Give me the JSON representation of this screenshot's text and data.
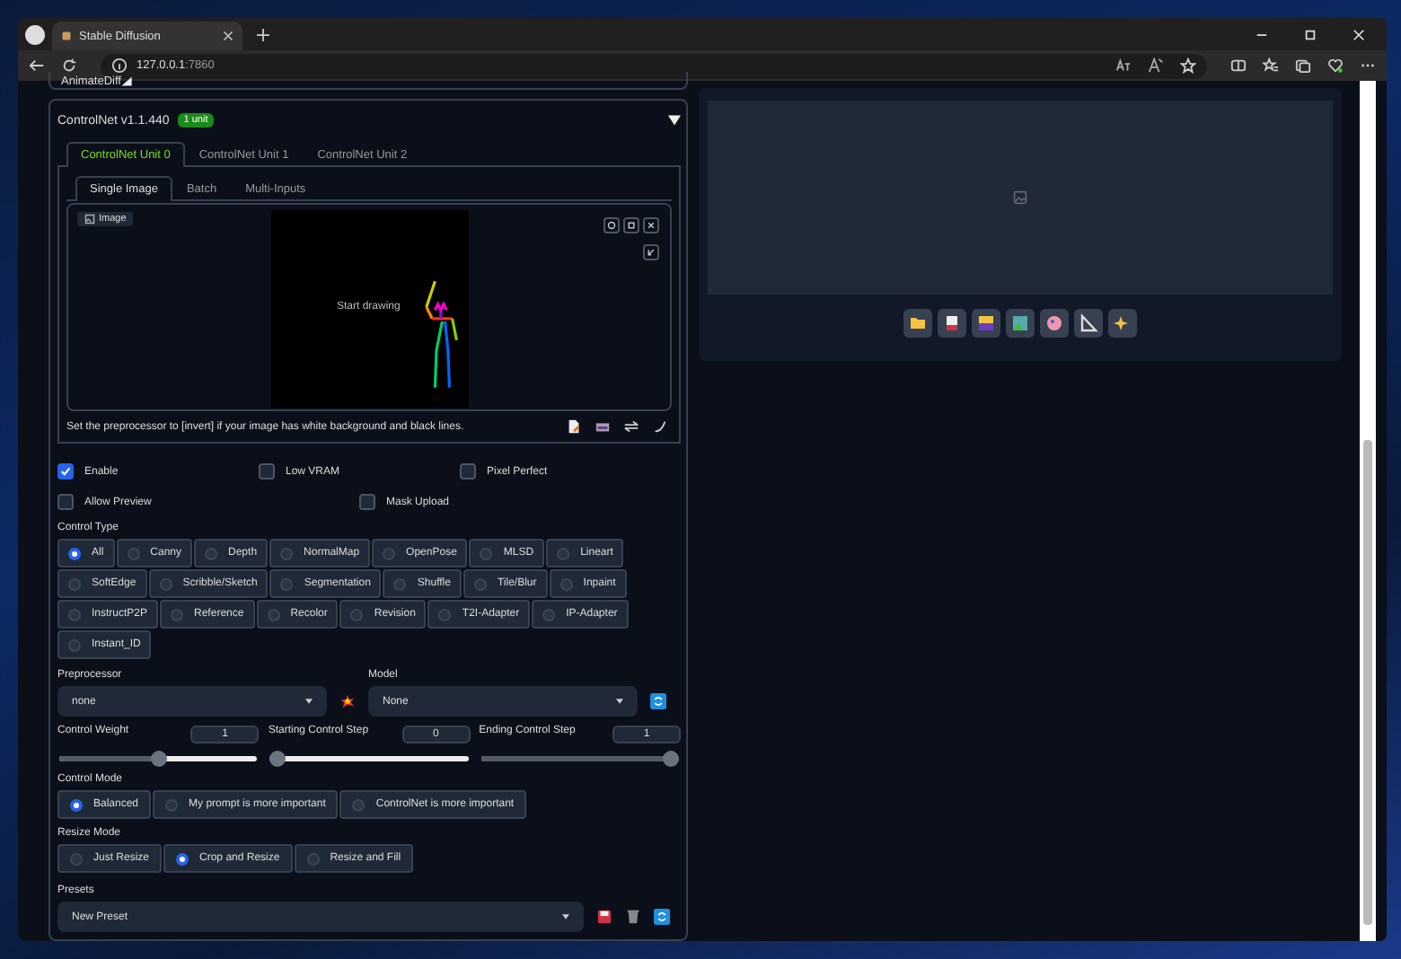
{
  "browser": {
    "tab_title": "Stable Diffusion",
    "address_host": "127.0.0.1",
    "address_port": ":7860"
  },
  "animatediff": {
    "title": "AnimateDiff"
  },
  "controlnet": {
    "title": "ControlNet v1.1.440",
    "badge": "1 unit",
    "expanded": true,
    "unit_tabs": [
      {
        "label": "ControlNet Unit 0",
        "selected": true
      },
      {
        "label": "ControlNet Unit 1",
        "selected": false
      },
      {
        "label": "ControlNet Unit 2",
        "selected": false
      }
    ],
    "input_tabs": [
      {
        "label": "Single Image",
        "selected": true
      },
      {
        "label": "Batch",
        "selected": false
      },
      {
        "label": "Multi-Inputs",
        "selected": false
      }
    ],
    "canvas": {
      "label": "Image",
      "hint": "Start drawing"
    },
    "note": "Set the preprocessor to [invert] if your image has white background and black lines.",
    "checkbox_rows": [
      [
        {
          "label": "Enable",
          "checked": true
        },
        {
          "label": "Low VRAM",
          "checked": false
        },
        {
          "label": "Pixel Perfect",
          "checked": false
        }
      ],
      [
        {
          "label": "Allow Preview",
          "checked": false
        },
        {
          "label": "Mask Upload",
          "checked": false
        }
      ]
    ],
    "control_type": {
      "label": "Control Type",
      "options": [
        {
          "label": "All",
          "selected": true
        },
        {
          "label": "Canny",
          "selected": false
        },
        {
          "label": "Depth",
          "selected": false
        },
        {
          "label": "NormalMap",
          "selected": false
        },
        {
          "label": "OpenPose",
          "selected": false
        },
        {
          "label": "MLSD",
          "selected": false
        },
        {
          "label": "Lineart",
          "selected": false
        },
        {
          "label": "SoftEdge",
          "selected": false
        },
        {
          "label": "Scribble/Sketch",
          "selected": false
        },
        {
          "label": "Segmentation",
          "selected": false
        },
        {
          "label": "Shuffle",
          "selected": false
        },
        {
          "label": "Tile/Blur",
          "selected": false
        },
        {
          "label": "Inpaint",
          "selected": false
        },
        {
          "label": "InstructP2P",
          "selected": false
        },
        {
          "label": "Reference",
          "selected": false
        },
        {
          "label": "Recolor",
          "selected": false
        },
        {
          "label": "Revision",
          "selected": false
        },
        {
          "label": "T2I-Adapter",
          "selected": false
        },
        {
          "label": "IP-Adapter",
          "selected": false
        },
        {
          "label": "Instant_ID",
          "selected": false
        }
      ]
    },
    "preprocessor": {
      "label": "Preprocessor",
      "value": "none"
    },
    "model": {
      "label": "Model",
      "value": "None"
    },
    "sliders": [
      {
        "label": "Control Weight",
        "value": "1",
        "level": 0.5
      },
      {
        "label": "Starting Control Step",
        "value": "0",
        "level": 0
      },
      {
        "label": "Ending Control Step",
        "value": "1",
        "level": 1
      }
    ],
    "control_mode": {
      "label": "Control Mode",
      "options": [
        {
          "label": "Balanced",
          "selected": true
        },
        {
          "label": "My prompt is more important",
          "selected": false
        },
        {
          "label": "ControlNet is more important",
          "selected": false
        }
      ]
    },
    "resize_mode": {
      "label": "Resize Mode",
      "options": [
        {
          "label": "Just Resize",
          "selected": false
        },
        {
          "label": "Crop and Resize",
          "selected": true
        },
        {
          "label": "Resize and Fill",
          "selected": false
        }
      ]
    },
    "presets": {
      "label": "Presets",
      "value": "New Preset"
    }
  }
}
